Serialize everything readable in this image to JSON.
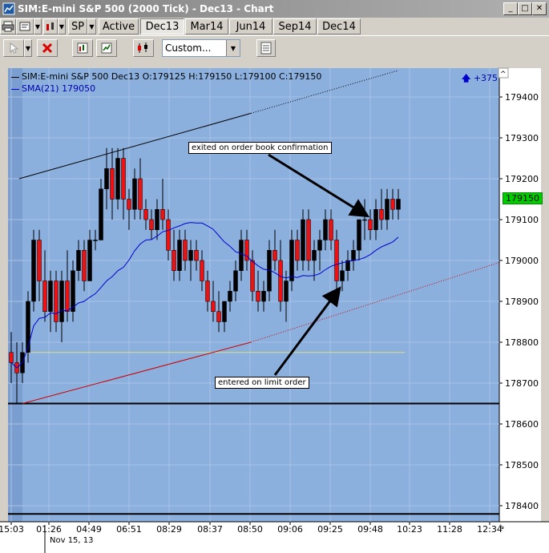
{
  "window": {
    "title": "SIM:E-mini S&P 500 (2000 Tick) - Dec13 - Chart",
    "minimize_glyph": "_",
    "maximize_glyph": "□",
    "close_glyph": "✕"
  },
  "toolbar": {
    "instrument": "SP",
    "tabs": [
      {
        "label": "Active",
        "selected": false
      },
      {
        "label": "Dec13",
        "selected": true
      },
      {
        "label": "Mar14",
        "selected": false
      },
      {
        "label": "Jun14",
        "selected": false
      },
      {
        "label": "Sep14",
        "selected": false
      },
      {
        "label": "Dec14",
        "selected": false
      }
    ],
    "template_select": "Custom...",
    "icons": [
      "printer-icon",
      "properties-icon",
      "delete-icon",
      "data-series-icon",
      "indicators-icon",
      "candlestick-icon",
      "data-box-icon"
    ]
  },
  "chart": {
    "header": "SIM:E-mini S&P 500 Dec13 O:179125 H:179150 L:179100 C:179150",
    "sma_label": "SMA(21)  179050",
    "pnl_indicator": "+375",
    "last_price": "179150",
    "annotation_exit": "exited on order book confirmation",
    "annotation_entry": "entered on limit order",
    "date_label": "Nov 15, 13",
    "colors": {
      "background": "#8cb0de",
      "left_panel": "#7a9ed0",
      "up_candle": "#000000",
      "down_candle": "#ee1111",
      "sma": "#0000cc",
      "last_price_tag": "#00cc00"
    }
  },
  "chart_data": {
    "type": "candlestick",
    "title": "SIM:E-mini S&P 500 (2000 Tick) - Dec13",
    "ylim": [
      178350,
      179500
    ],
    "y_ticks": [
      179400,
      179300,
      179200,
      179100,
      179000,
      178900,
      178800,
      178700,
      178600,
      178500,
      178400
    ],
    "x_ticks": [
      "15:03",
      "01:26",
      "04:49",
      "06:51",
      "08:29",
      "08:37",
      "08:50",
      "09:06",
      "09:25",
      "09:48",
      "10:23",
      "11:28",
      "12:34"
    ],
    "candles": [
      {
        "o": 178775,
        "h": 178825,
        "l": 178700,
        "c": 178750
      },
      {
        "o": 178750,
        "h": 178800,
        "l": 178650,
        "c": 178725
      },
      {
        "o": 178725,
        "h": 178800,
        "l": 178700,
        "c": 178775
      },
      {
        "o": 178775,
        "h": 178925,
        "l": 178750,
        "c": 178900
      },
      {
        "o": 178900,
        "h": 179075,
        "l": 178875,
        "c": 179050
      },
      {
        "o": 179050,
        "h": 179075,
        "l": 178900,
        "c": 178950
      },
      {
        "o": 178950,
        "h": 179025,
        "l": 178850,
        "c": 178875
      },
      {
        "o": 178875,
        "h": 178975,
        "l": 178825,
        "c": 178950
      },
      {
        "o": 178950,
        "h": 178975,
        "l": 178825,
        "c": 178850
      },
      {
        "o": 178850,
        "h": 178975,
        "l": 178800,
        "c": 178950
      },
      {
        "o": 178950,
        "h": 179025,
        "l": 178850,
        "c": 178875
      },
      {
        "o": 178875,
        "h": 179000,
        "l": 178850,
        "c": 178975
      },
      {
        "o": 178975,
        "h": 179050,
        "l": 178950,
        "c": 179025
      },
      {
        "o": 179025,
        "h": 179050,
        "l": 178925,
        "c": 178950
      },
      {
        "o": 178950,
        "h": 179075,
        "l": 178950,
        "c": 179050
      },
      {
        "o": 179050,
        "h": 179075,
        "l": 179025,
        "c": 179050
      },
      {
        "o": 179050,
        "h": 179200,
        "l": 179050,
        "c": 179175
      },
      {
        "o": 179175,
        "h": 179275,
        "l": 179125,
        "c": 179225
      },
      {
        "o": 179225,
        "h": 179275,
        "l": 179100,
        "c": 179150
      },
      {
        "o": 179150,
        "h": 179275,
        "l": 179125,
        "c": 179250
      },
      {
        "o": 179250,
        "h": 179275,
        "l": 179100,
        "c": 179150
      },
      {
        "o": 179150,
        "h": 179175,
        "l": 179075,
        "c": 179125
      },
      {
        "o": 179125,
        "h": 179225,
        "l": 179100,
        "c": 179200
      },
      {
        "o": 179200,
        "h": 179250,
        "l": 179100,
        "c": 179125
      },
      {
        "o": 179125,
        "h": 179150,
        "l": 179075,
        "c": 179100
      },
      {
        "o": 179100,
        "h": 179125,
        "l": 179050,
        "c": 179075
      },
      {
        "o": 179075,
        "h": 179150,
        "l": 179050,
        "c": 179125
      },
      {
        "o": 179125,
        "h": 179200,
        "l": 179075,
        "c": 179100
      },
      {
        "o": 179100,
        "h": 179125,
        "l": 179000,
        "c": 179025
      },
      {
        "o": 179025,
        "h": 179075,
        "l": 178950,
        "c": 178975
      },
      {
        "o": 178975,
        "h": 179075,
        "l": 178950,
        "c": 179050
      },
      {
        "o": 179050,
        "h": 179075,
        "l": 178975,
        "c": 179000
      },
      {
        "o": 179000,
        "h": 179050,
        "l": 178950,
        "c": 179025
      },
      {
        "o": 179025,
        "h": 179050,
        "l": 178975,
        "c": 179000
      },
      {
        "o": 179000,
        "h": 179025,
        "l": 178925,
        "c": 178950
      },
      {
        "o": 178950,
        "h": 178975,
        "l": 178875,
        "c": 178900
      },
      {
        "o": 178900,
        "h": 178950,
        "l": 178850,
        "c": 178875
      },
      {
        "o": 178875,
        "h": 178925,
        "l": 178825,
        "c": 178850
      },
      {
        "o": 178850,
        "h": 178900,
        "l": 178825,
        "c": 178900
      },
      {
        "o": 178900,
        "h": 178950,
        "l": 178875,
        "c": 178925
      },
      {
        "o": 178925,
        "h": 179000,
        "l": 178900,
        "c": 178975
      },
      {
        "o": 178975,
        "h": 179075,
        "l": 178950,
        "c": 179050
      },
      {
        "o": 179050,
        "h": 179075,
        "l": 178975,
        "c": 179000
      },
      {
        "o": 179000,
        "h": 179025,
        "l": 178900,
        "c": 178925
      },
      {
        "o": 178925,
        "h": 178975,
        "l": 178875,
        "c": 178900
      },
      {
        "o": 178900,
        "h": 178950,
        "l": 178875,
        "c": 178925
      },
      {
        "o": 178925,
        "h": 179050,
        "l": 178900,
        "c": 179025
      },
      {
        "o": 179025,
        "h": 179075,
        "l": 178975,
        "c": 179000
      },
      {
        "o": 179000,
        "h": 179050,
        "l": 178875,
        "c": 178900
      },
      {
        "o": 178900,
        "h": 178975,
        "l": 178850,
        "c": 178950
      },
      {
        "o": 178950,
        "h": 179075,
        "l": 178925,
        "c": 179050
      },
      {
        "o": 179050,
        "h": 179075,
        "l": 178975,
        "c": 179000
      },
      {
        "o": 179000,
        "h": 179125,
        "l": 178975,
        "c": 179100
      },
      {
        "o": 179100,
        "h": 179125,
        "l": 178975,
        "c": 179000
      },
      {
        "o": 179000,
        "h": 179050,
        "l": 178950,
        "c": 179025
      },
      {
        "o": 179025,
        "h": 179075,
        "l": 178975,
        "c": 179050
      },
      {
        "o": 179050,
        "h": 179125,
        "l": 179025,
        "c": 179100
      },
      {
        "o": 179100,
        "h": 179125,
        "l": 179025,
        "c": 179050
      },
      {
        "o": 179050,
        "h": 179075,
        "l": 178925,
        "c": 178950
      },
      {
        "o": 178950,
        "h": 179000,
        "l": 178925,
        "c": 178975
      },
      {
        "o": 178975,
        "h": 179025,
        "l": 178950,
        "c": 179000
      },
      {
        "o": 179000,
        "h": 179050,
        "l": 178975,
        "c": 179025
      },
      {
        "o": 179025,
        "h": 179100,
        "l": 179000,
        "c": 179100
      },
      {
        "o": 179100,
        "h": 179150,
        "l": 179050,
        "c": 179100
      },
      {
        "o": 179100,
        "h": 179125,
        "l": 179050,
        "c": 179075
      },
      {
        "o": 179075,
        "h": 179150,
        "l": 179050,
        "c": 179125
      },
      {
        "o": 179125,
        "h": 179175,
        "l": 179075,
        "c": 179100
      },
      {
        "o": 179100,
        "h": 179175,
        "l": 179075,
        "c": 179150
      },
      {
        "o": 179150,
        "h": 179175,
        "l": 179100,
        "c": 179125
      },
      {
        "o": 179125,
        "h": 179175,
        "l": 179100,
        "c": 179150
      }
    ],
    "sma": {
      "name": "SMA(21)",
      "period": 21,
      "last": 179050
    },
    "horizontal_lines": [
      {
        "price": 178775,
        "color": "#dede80"
      },
      {
        "price": 178650,
        "color": "#000000"
      },
      {
        "price": 178380,
        "color": "#000000"
      }
    ],
    "trend_lines": [
      {
        "from": {
          "bar": 0,
          "price": 178650
        },
        "to": {
          "bar": 69,
          "price": 178920
        },
        "color": "#cc0000"
      },
      {
        "from": {
          "bar": 0,
          "price": 179200
        },
        "to": {
          "bar": 69,
          "price": 179490
        },
        "color": "#000000"
      }
    ],
    "grid": true
  }
}
